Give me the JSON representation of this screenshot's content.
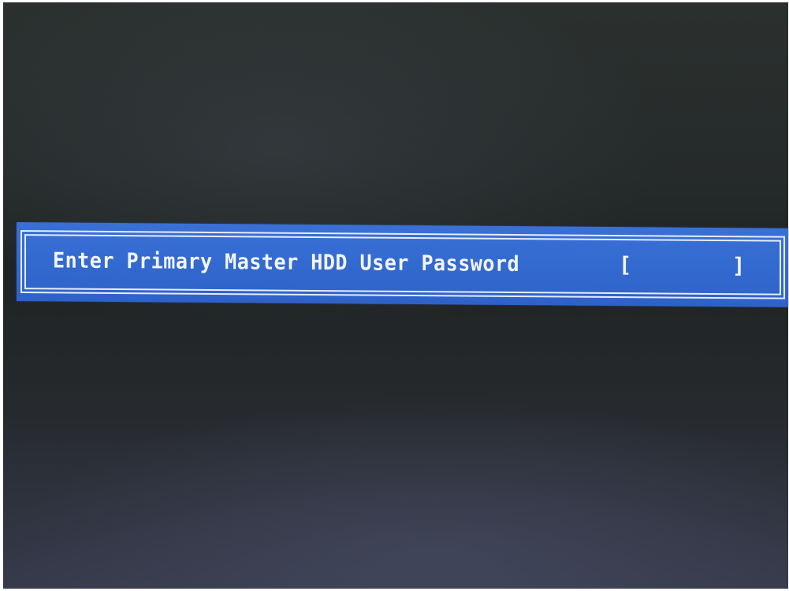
{
  "dialog": {
    "prompt_label": "Enter Primary Master HDD User Password",
    "bracket_open": "[",
    "bracket_close": "]",
    "password_value": ""
  },
  "colors": {
    "dialog_background": "#336ad0",
    "frame_border": "#e6ecff",
    "text": "#f3f5ff",
    "screen_background": "#252a2a"
  }
}
